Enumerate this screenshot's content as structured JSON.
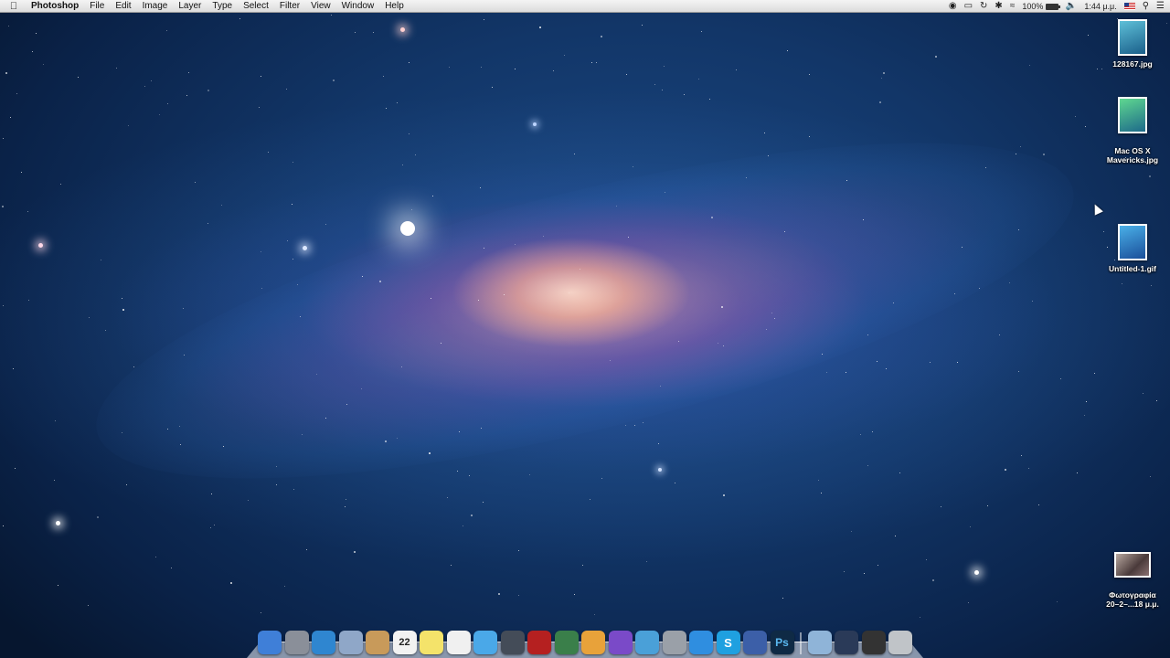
{
  "menubar": {
    "apple_icon": "apple-logo-icon",
    "app_name": "Photoshop",
    "items": [
      "File",
      "Edit",
      "Image",
      "Layer",
      "Type",
      "Select",
      "Filter",
      "View",
      "Window",
      "Help"
    ],
    "status": {
      "battery_text": "100%",
      "battery_level": 1.0,
      "time": "1:44 μ.μ.",
      "icons": [
        "record-icon",
        "airplay-icon",
        "time-machine-icon",
        "bluetooth-icon",
        "wifi-icon",
        "volume-icon",
        "us-flag-icon",
        "spotlight-search-icon",
        "notification-center-icon"
      ]
    }
  },
  "desktop": {
    "icons": [
      {
        "label": "128167.jpg",
        "color": "#2f8fb0"
      },
      {
        "label": "Mac OS X\nMavericks.jpg",
        "color": "#2a9f6a"
      },
      {
        "label": "Untitled-1.gif",
        "color": "#2f86c8"
      },
      {
        "label": "Φωτογραφία\n20–2–...18 μ.μ.",
        "color": "#6d5a55"
      }
    ]
  },
  "dock": {
    "items": [
      {
        "name": "finder",
        "icon": "finder-icon",
        "color": "#3f7fd8"
      },
      {
        "name": "launchpad",
        "icon": "launchpad-icon",
        "color": "#8a8f99"
      },
      {
        "name": "safari",
        "icon": "safari-icon",
        "color": "#2f86d0"
      },
      {
        "name": "mail",
        "icon": "mail-icon",
        "color": "#8fa7c8"
      },
      {
        "name": "contacts",
        "icon": "contacts-icon",
        "color": "#c89a5a"
      },
      {
        "name": "calendar",
        "icon": "calendar-icon",
        "color": "#f2f2f2",
        "text": "22"
      },
      {
        "name": "notes",
        "icon": "notes-icon",
        "color": "#f4e36a"
      },
      {
        "name": "reminders",
        "icon": "reminders-icon",
        "color": "#f0f0f0"
      },
      {
        "name": "messages",
        "icon": "messages-icon",
        "color": "#4aa8e8"
      },
      {
        "name": "facetime",
        "icon": "facetime-icon",
        "color": "#444c58"
      },
      {
        "name": "photo-booth",
        "icon": "photo-booth-icon",
        "color": "#b52020"
      },
      {
        "name": "iphoto",
        "icon": "iphoto-icon",
        "color": "#3a7f4a"
      },
      {
        "name": "pages",
        "icon": "pages-icon",
        "color": "#e8a23a"
      },
      {
        "name": "numbers",
        "icon": "numbers-icon",
        "color": "#7a4ac8"
      },
      {
        "name": "keynote",
        "icon": "keynote-icon",
        "color": "#4aa0d8"
      },
      {
        "name": "system-preferences",
        "icon": "system-preferences-icon",
        "color": "#9aa0a8"
      },
      {
        "name": "app-store",
        "icon": "app-store-icon",
        "color": "#2f8ee0"
      },
      {
        "name": "skype",
        "icon": "skype-icon",
        "color": "#1fa0e0",
        "text": "S"
      },
      {
        "name": "quicktime",
        "icon": "quicktime-icon",
        "color": "#3c5fa8"
      },
      {
        "name": "photoshop",
        "icon": "photoshop-icon",
        "color": "#0f2a45",
        "text": "Ps"
      },
      {
        "name": "applications-folder",
        "icon": "folder-icon",
        "color": "#8fb4d8"
      },
      {
        "name": "desktop-stack",
        "icon": "window-stack-icon",
        "color": "#2a3a58"
      },
      {
        "name": "screen-stack",
        "icon": "screen-stack-icon",
        "color": "#333"
      },
      {
        "name": "trash",
        "icon": "trash-icon",
        "color": "#c0c4c8"
      }
    ]
  }
}
